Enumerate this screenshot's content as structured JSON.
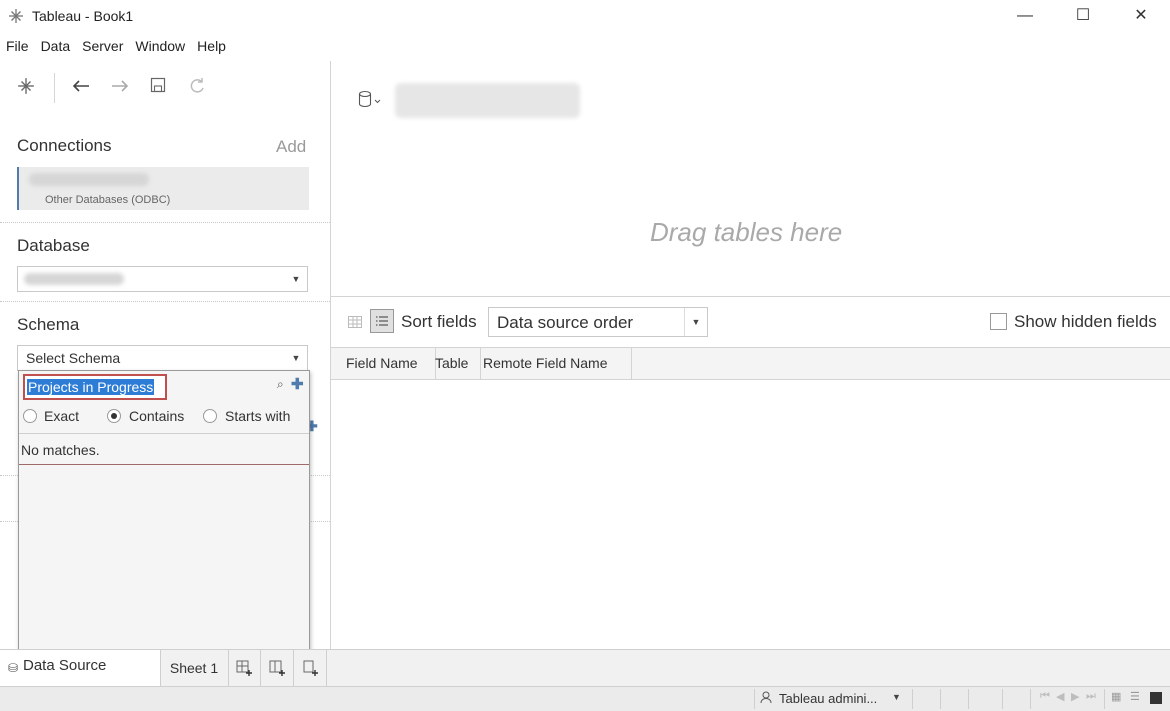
{
  "window": {
    "title": "Tableau - Book1",
    "minimize": "—",
    "maximize": "☐",
    "close": "✕"
  },
  "menu": [
    "File",
    "Data",
    "Server",
    "Window",
    "Help"
  ],
  "toolbar": {
    "icons": [
      "tableau-logo-icon",
      "back-icon",
      "forward-icon",
      "save-icon",
      "refresh-icon"
    ]
  },
  "connections": {
    "title": "Connections",
    "add_label": "Add",
    "item_type": "Other Databases (ODBC)"
  },
  "database": {
    "title": "Database"
  },
  "schema": {
    "title": "Schema",
    "select_value": "Select Schema"
  },
  "search_popup": {
    "input_value": "Projects in Progress",
    "options": [
      "Exact",
      "Contains",
      "Starts with"
    ],
    "selected_option": "Contains",
    "result_text": "No matches."
  },
  "canvas": {
    "drag_hint": "Drag tables here"
  },
  "sort_bar": {
    "sort_label": "Sort fields",
    "sort_value": "Data source order",
    "show_hidden_label": "Show hidden fields",
    "show_hidden_checked": false
  },
  "grid": {
    "columns": [
      "Field Name",
      "Table",
      "Remote Field Name"
    ]
  },
  "tabs": {
    "data_source": "Data Source",
    "sheet1": "Sheet 1"
  },
  "status": {
    "user": "Tableau admini..."
  },
  "colors": {
    "accent": "#4f7cad",
    "selection": "#2d7cd6",
    "focus_border": "#c0504d"
  }
}
